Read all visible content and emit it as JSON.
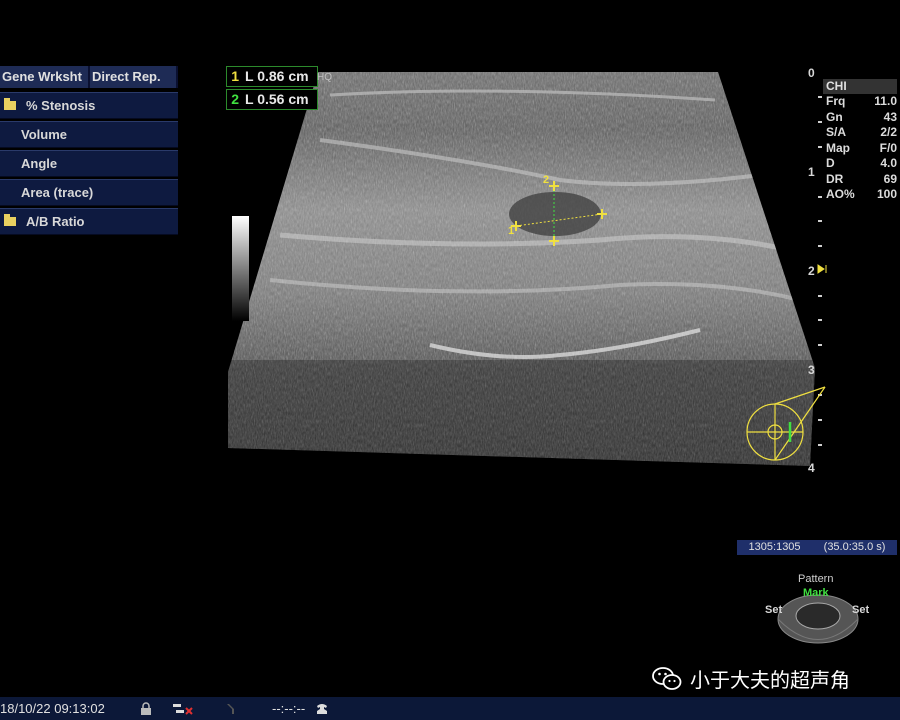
{
  "worksheet": {
    "tabs": [
      "Gene Wrksht",
      "Direct Rep."
    ],
    "menu": [
      {
        "label": "% Stenosis",
        "folder": true
      },
      {
        "label": "Volume",
        "folder": false
      },
      {
        "label": "Angle",
        "folder": false
      },
      {
        "label": "Area (trace)",
        "folder": false
      },
      {
        "label": "A/B Ratio",
        "folder": true
      }
    ]
  },
  "measurements": [
    {
      "index": "1",
      "label": "L 0.86 cm"
    },
    {
      "index": "2",
      "label": "L 0.56 cm"
    }
  ],
  "hiq": "HQ",
  "params": {
    "title": "CHI",
    "rows": [
      {
        "k": "Frq",
        "v": "11.0"
      },
      {
        "k": "Gn",
        "v": "43"
      },
      {
        "k": "S/A",
        "v": "2/2"
      },
      {
        "k": "Map",
        "v": "F/0"
      },
      {
        "k": "D",
        "v": "4.0"
      },
      {
        "k": "DR",
        "v": "69"
      },
      {
        "k": "AO%",
        "v": "100"
      }
    ]
  },
  "depth_labels": [
    "0",
    "1",
    "2",
    "3",
    "4"
  ],
  "caliper_labels": {
    "one": "1",
    "two": "2"
  },
  "cine": {
    "frames": "1305:1305",
    "time": "(35.0:35.0 s)"
  },
  "pattern": {
    "title": "Pattern",
    "mark": "Mark",
    "set_left": "Set",
    "set_right": "Set"
  },
  "watermark": {
    "text": "小于大夫的超声角"
  },
  "status": {
    "datetime": "18/10/22 09:13:02",
    "cine_time": "--:--:--"
  },
  "colors": {
    "caliper": "#f0e040",
    "green": "#40e040",
    "panel": "#0e1a40"
  }
}
